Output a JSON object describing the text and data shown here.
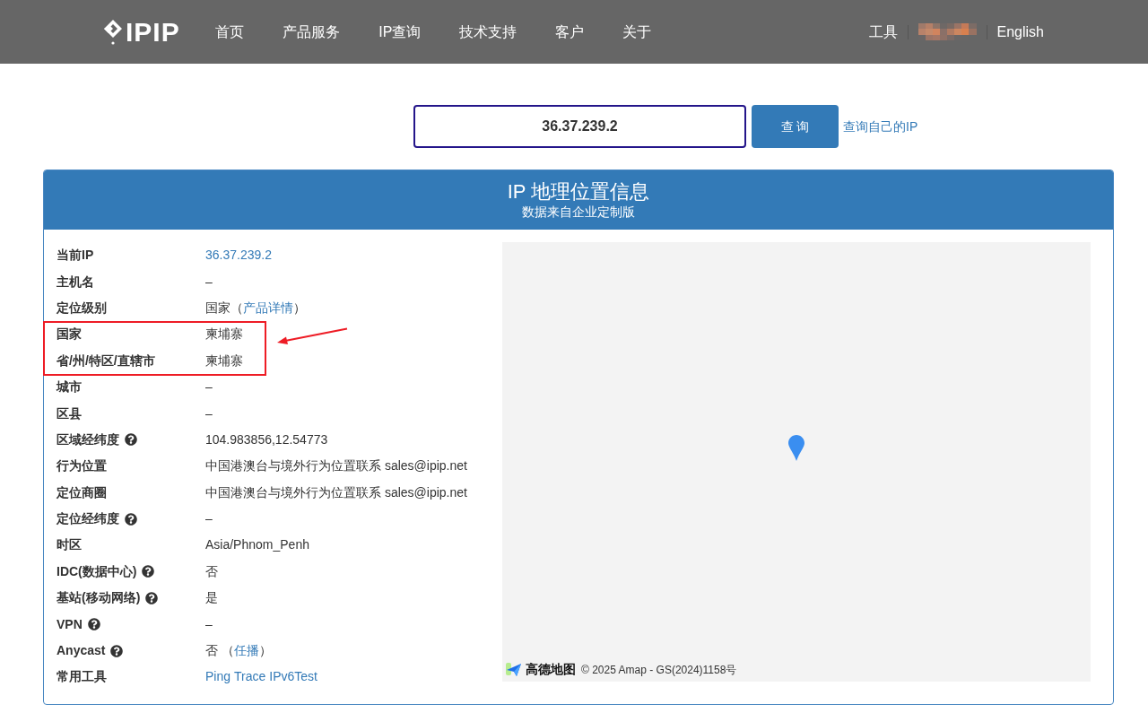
{
  "header": {
    "logo_text": "IPIP",
    "nav": [
      "首页",
      "产品服务",
      "IP查询",
      "技术支持",
      "客户",
      "关于"
    ],
    "right_items": [
      {
        "kind": "link",
        "label": "工具"
      },
      {
        "kind": "redacted"
      },
      {
        "kind": "link",
        "label": "English"
      }
    ]
  },
  "search": {
    "value": "36.37.239.2",
    "button": "查 询",
    "link": "查询自己的IP"
  },
  "panel": {
    "title": "IP 地理位置信息",
    "subtitle": "数据来自企业定制版",
    "rows": [
      {
        "label": "当前IP",
        "help": false,
        "highlighted": false,
        "value": [
          {
            "kind": "link",
            "text": "36.37.239.2"
          }
        ]
      },
      {
        "label": "主机名",
        "help": false,
        "highlighted": false,
        "value": [
          {
            "kind": "text",
            "text": "–"
          }
        ]
      },
      {
        "label": "定位级别",
        "help": false,
        "highlighted": false,
        "value": [
          {
            "kind": "text",
            "text": "国家（"
          },
          {
            "kind": "link",
            "text": "产品详情"
          },
          {
            "kind": "text",
            "text": "）"
          }
        ]
      },
      {
        "label": "国家",
        "help": false,
        "highlighted": true,
        "value": [
          {
            "kind": "text",
            "text": "柬埔寨"
          }
        ]
      },
      {
        "label": "省/州/特区/直辖市",
        "help": false,
        "highlighted": true,
        "value": [
          {
            "kind": "text",
            "text": "柬埔寨"
          }
        ]
      },
      {
        "label": "城市",
        "help": false,
        "highlighted": false,
        "value": [
          {
            "kind": "text",
            "text": "–"
          }
        ]
      },
      {
        "label": "区县",
        "help": false,
        "highlighted": false,
        "value": [
          {
            "kind": "text",
            "text": "–"
          }
        ]
      },
      {
        "label": "区域经纬度",
        "help": true,
        "highlighted": false,
        "value": [
          {
            "kind": "text",
            "text": "104.983856,12.54773"
          }
        ]
      },
      {
        "label": "行为位置",
        "help": false,
        "highlighted": false,
        "value": [
          {
            "kind": "text",
            "text": "中国港澳台与境外行为位置联系 sales@ipip.net"
          }
        ]
      },
      {
        "label": "定位商圈",
        "help": false,
        "highlighted": false,
        "value": [
          {
            "kind": "text",
            "text": "中国港澳台与境外行为位置联系 sales@ipip.net"
          }
        ]
      },
      {
        "label": "定位经纬度",
        "help": true,
        "highlighted": false,
        "value": [
          {
            "kind": "text",
            "text": "–"
          }
        ]
      },
      {
        "label": "时区",
        "help": false,
        "highlighted": false,
        "value": [
          {
            "kind": "text",
            "text": "Asia/Phnom_Penh"
          }
        ]
      },
      {
        "label": "IDC(数据中心)",
        "help": true,
        "highlighted": false,
        "value": [
          {
            "kind": "text",
            "text": "否"
          }
        ]
      },
      {
        "label": "基站(移动网络)",
        "help": true,
        "highlighted": false,
        "value": [
          {
            "kind": "text",
            "text": "是"
          }
        ]
      },
      {
        "label": "VPN",
        "help": true,
        "highlighted": false,
        "value": [
          {
            "kind": "text",
            "text": "–"
          }
        ]
      },
      {
        "label": "Anycast",
        "help": true,
        "highlighted": false,
        "value": [
          {
            "kind": "text",
            "text": "否 （"
          },
          {
            "kind": "link",
            "text": "任播"
          },
          {
            "kind": "text",
            "text": "）"
          }
        ]
      },
      {
        "label": "常用工具",
        "help": false,
        "highlighted": false,
        "value": [
          {
            "kind": "link",
            "text": "Ping"
          },
          {
            "kind": "link",
            "text": "Trace"
          },
          {
            "kind": "link",
            "text": "IPv6Test"
          }
        ]
      }
    ],
    "map": {
      "logo_text": "高德地图",
      "attribution": "© 2025 Amap - GS(2024)1158号"
    }
  }
}
